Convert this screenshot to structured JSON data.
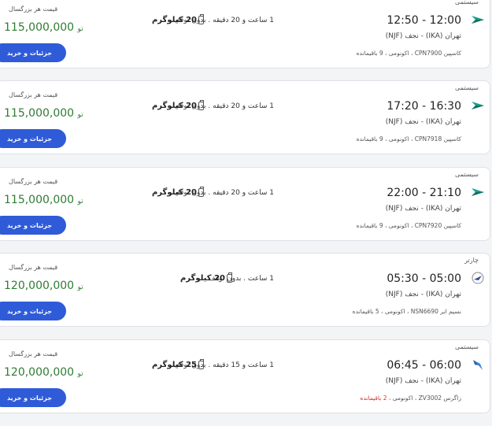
{
  "flights": [
    {
      "type": "سیستمی",
      "airline_icon": "caspian-logo",
      "times": "12:50 - 12:00",
      "route": "تهران (IKA) - نجف (NJF)",
      "airline_flight": "کاسپین CPN7900",
      "cabin": "اکونومی",
      "seats": "9 باقیمانده",
      "seats_low": false,
      "duration_stops": "1 ساعت و 20 دقیقه . بدون توقف",
      "baggage": "20 کیلوگرم",
      "price_label": "قیمت هر بزرگسال",
      "price": "115,000,000",
      "currency": "تو",
      "button": "جزئیات و خرید"
    },
    {
      "type": "سیستمی",
      "airline_icon": "caspian-logo",
      "times": "17:20 - 16:30",
      "route": "تهران (IKA) - نجف (NJF)",
      "airline_flight": "کاسپین CPN7918",
      "cabin": "اکونومی",
      "seats": "9 باقیمانده",
      "seats_low": false,
      "duration_stops": "1 ساعت و 20 دقیقه . بدون توقف",
      "baggage": "20 کیلوگرم",
      "price_label": "قیمت هر بزرگسال",
      "price": "115,000,000",
      "currency": "تو",
      "button": "جزئیات و خرید"
    },
    {
      "type": "سیستمی",
      "airline_icon": "caspian-logo",
      "times": "22:00 - 21:10",
      "route": "تهران (IKA) - نجف (NJF)",
      "airline_flight": "کاسپین CPN7920",
      "cabin": "اکونومی",
      "seats": "9 باقیمانده",
      "seats_low": false,
      "duration_stops": "1 ساعت و 20 دقیقه . بدون توقف",
      "baggage": "20 کیلوگرم",
      "price_label": "قیمت هر بزرگسال",
      "price": "115,000,000",
      "currency": "تو",
      "button": "جزئیات و خرید"
    },
    {
      "type": "چارتر",
      "airline_icon": "naseem-air-logo",
      "times": "05:30 - 05:00",
      "route": "تهران (IKA) - نجف (NJF)",
      "airline_flight": "نسیم ایر NSN6690",
      "cabin": "اکونومی",
      "seats": "5 باقیمانده",
      "seats_low": false,
      "duration_stops": "1 ساعت . بدون توقف",
      "baggage": "20 کیلوگرم",
      "price_label": "قیمت هر بزرگسال",
      "price": "120,000,000",
      "currency": "تو",
      "button": "جزئیات و خرید"
    },
    {
      "type": "سیستمی",
      "airline_icon": "zagros-logo",
      "times": "06:45 - 06:00",
      "route": "تهران (IKA) - نجف (NJF)",
      "airline_flight": "زاگرس ZV3002",
      "cabin": "اکونومی",
      "seats": "2 باقیمانده",
      "seats_low": true,
      "duration_stops": "1 ساعت و 15 دقیقه . بدون توقف",
      "baggage": "25 کیلوگرم",
      "price_label": "قیمت هر بزرگسال",
      "price": "120,000,000",
      "currency": "تو",
      "button": "جزئیات و خرید"
    }
  ],
  "colors": {
    "price": "#2e7d32",
    "button": "#2f5bd8",
    "low_seats": "#d32f2f",
    "caspian_logo": "#1a9e8f",
    "zagros_logo": "#3b7fd8"
  }
}
